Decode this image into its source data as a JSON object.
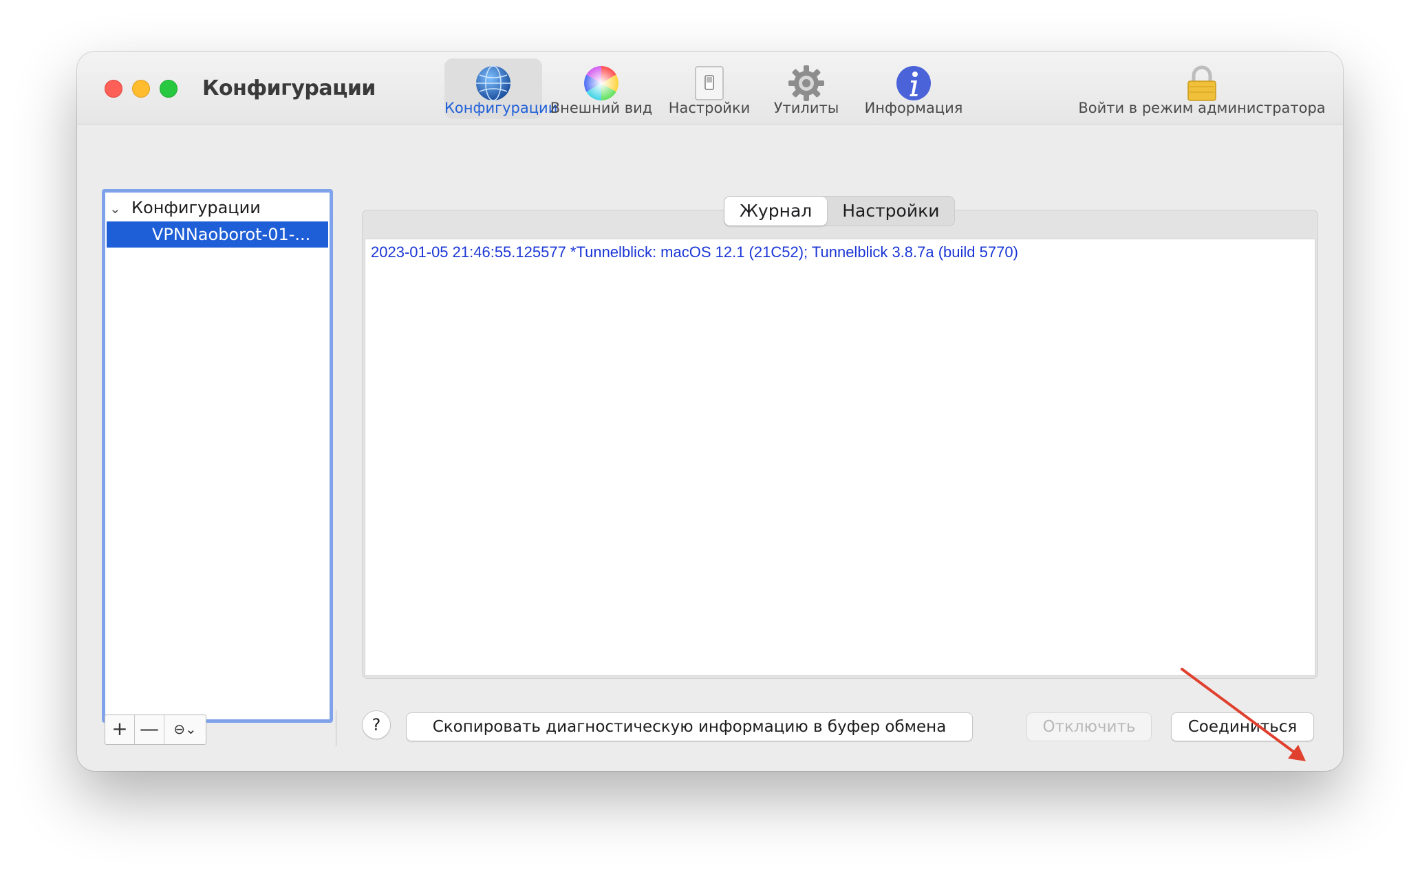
{
  "window": {
    "title": "Конфигурации"
  },
  "toolbar": {
    "items": [
      {
        "label": "Конфигурации",
        "icon": "globe-icon",
        "active": true
      },
      {
        "label": "Внешний вид",
        "icon": "color-wheel-icon"
      },
      {
        "label": "Настройки",
        "icon": "switch-icon"
      },
      {
        "label": "Утилиты",
        "icon": "gear-icon"
      },
      {
        "label": "Информация",
        "icon": "info-icon"
      }
    ],
    "admin_label": "Войти в режим администратора",
    "admin_icon": "lock-icon"
  },
  "sidebar": {
    "group_label": "Конфигурации",
    "selected_item": "VPNNaoborot-01-...",
    "buttons": {
      "add": "+",
      "remove": "—",
      "more": "⊖⌄"
    }
  },
  "tabs": {
    "log": "Журнал",
    "settings": "Настройки",
    "active": "log"
  },
  "log": {
    "lines": [
      "2023-01-05 21:46:55.125577 *Tunnelblick: macOS 12.1 (21C52); Tunnelblick 3.8.7a (build 5770)"
    ]
  },
  "footer": {
    "help": "?",
    "copy_diagnostics": "Скопировать диагностическую информацию в буфер обмена",
    "disconnect": "Отключить",
    "connect": "Соединиться"
  },
  "colors": {
    "accent": "#1e5ed6",
    "log_text": "#1a35d6",
    "annotation_arrow": "#e0402e"
  }
}
